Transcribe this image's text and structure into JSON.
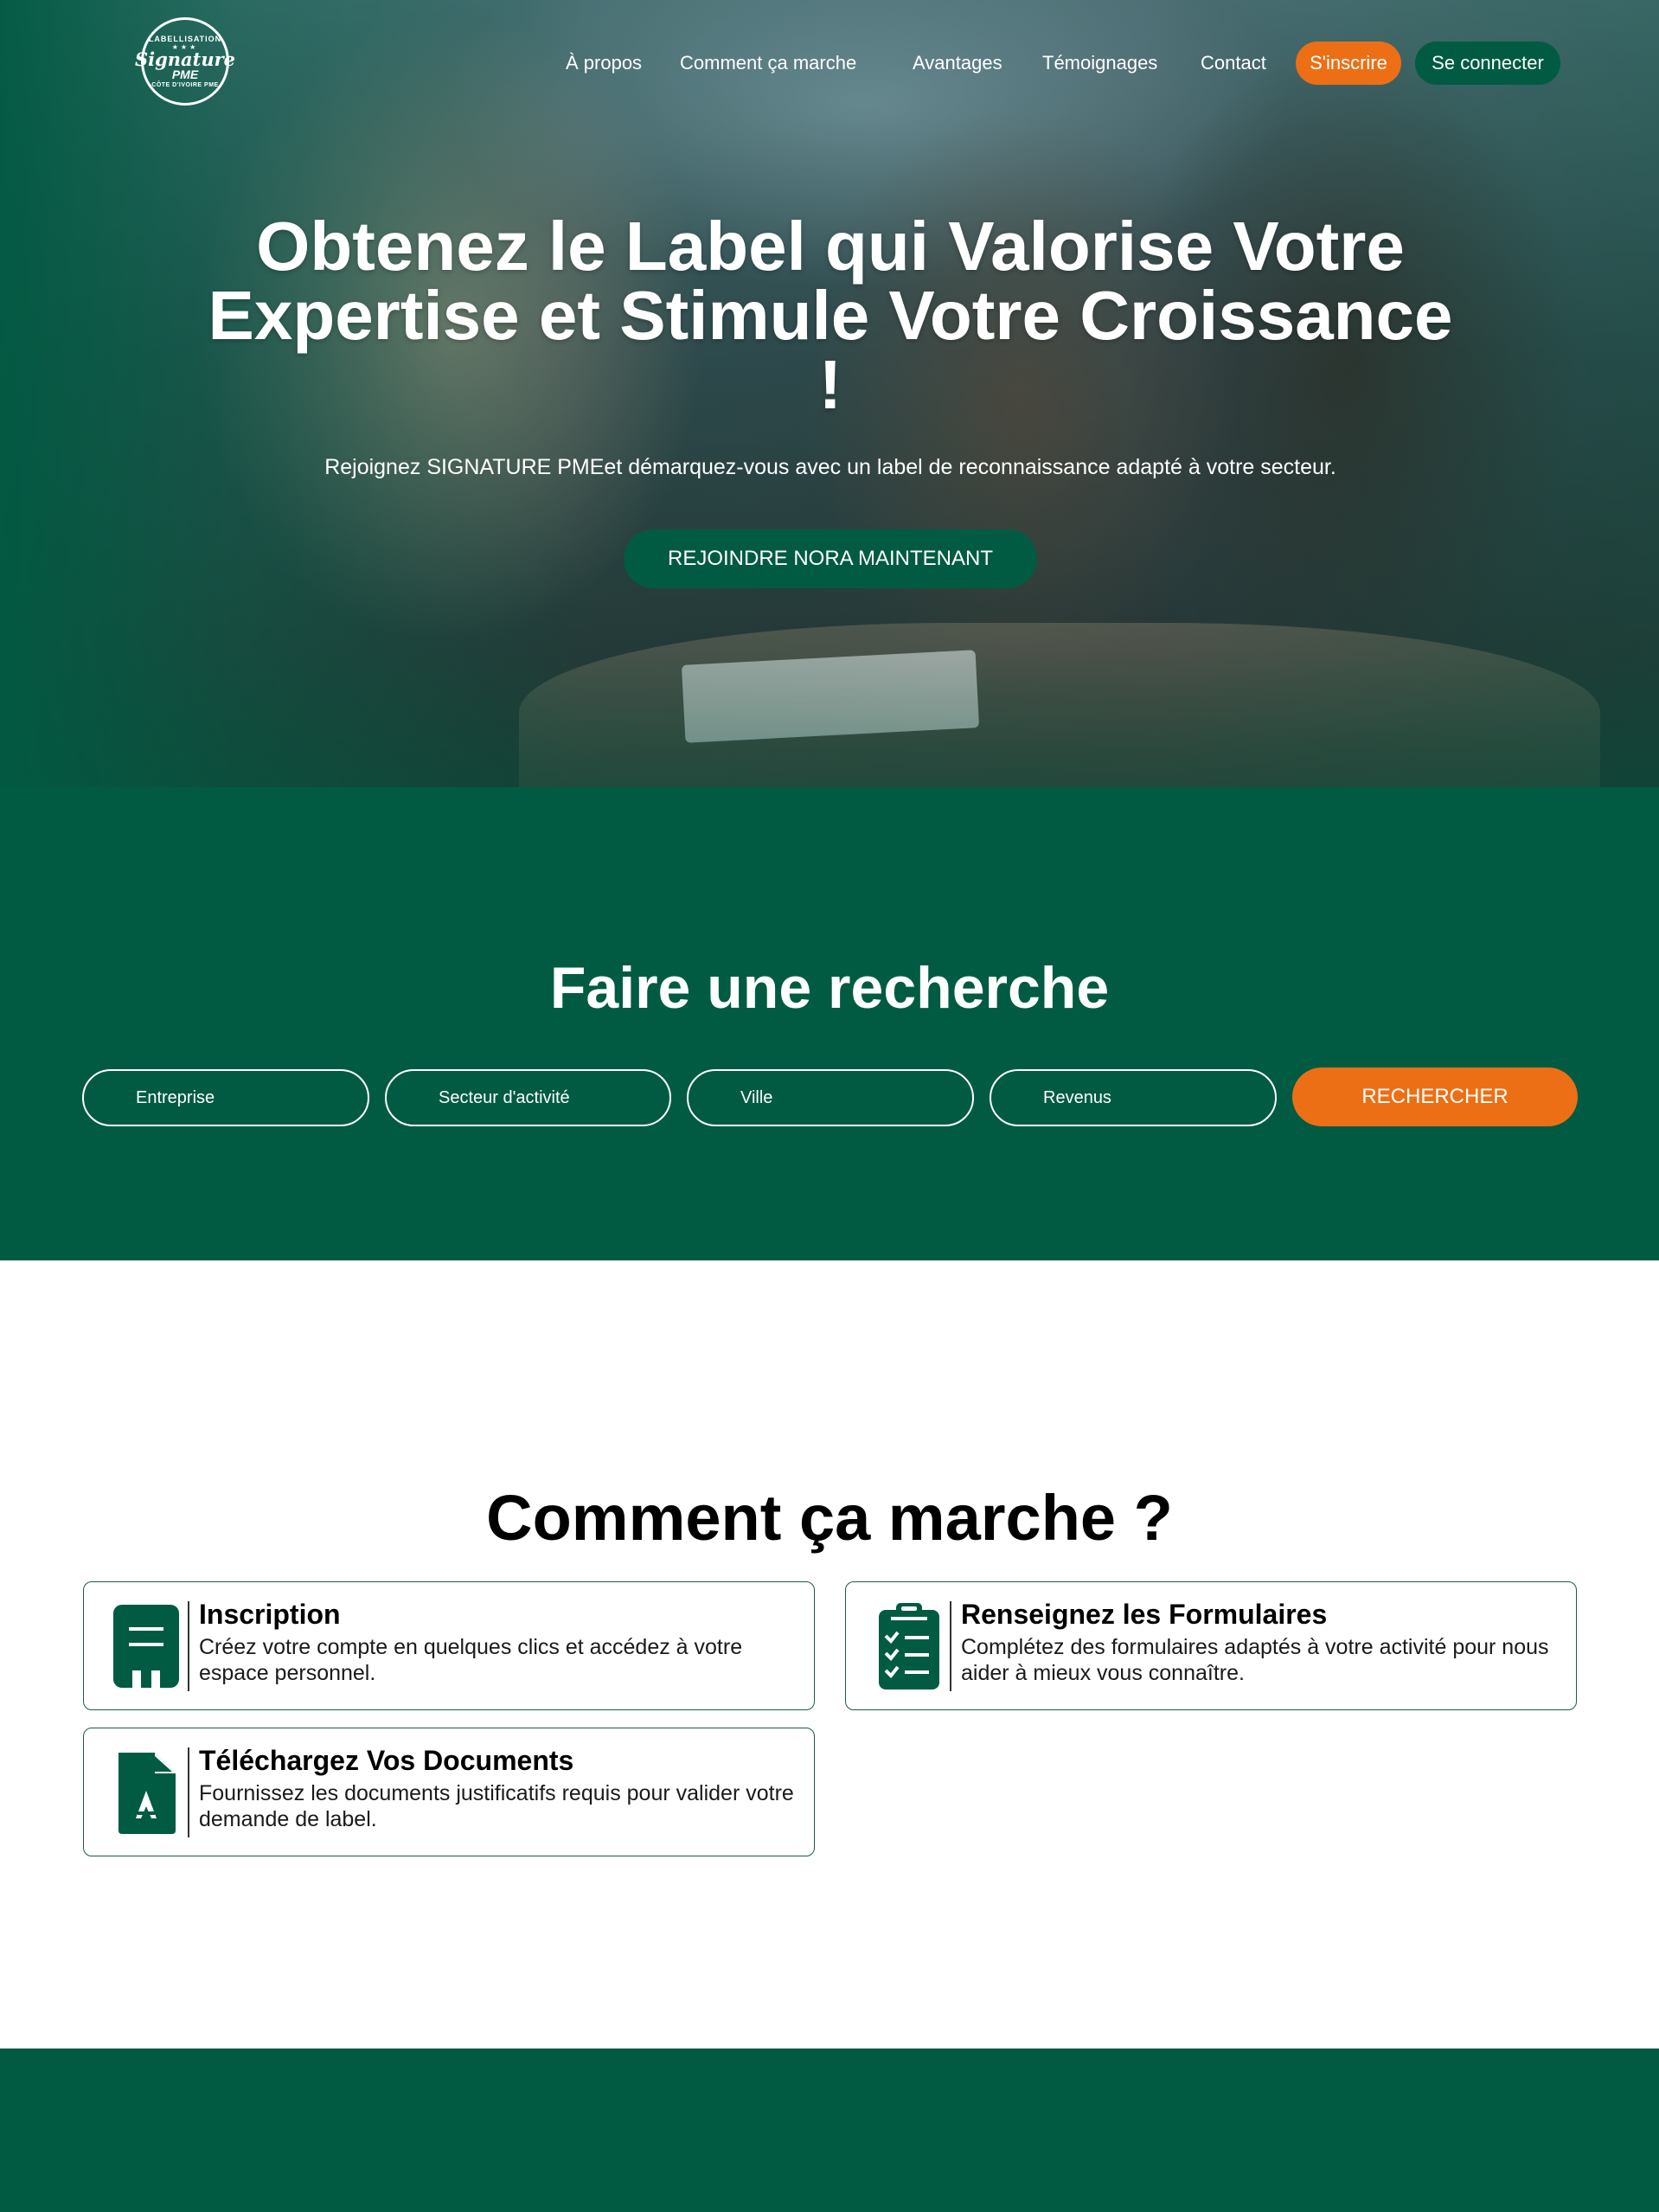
{
  "brand": {
    "logo_top_text": "LABELLISATION",
    "logo_script": "Signature",
    "logo_pme": "PME",
    "logo_bottom_text": "CÔTE D'IVOIRE PME"
  },
  "nav": {
    "items": [
      "À propos",
      "Comment ça marche",
      "Avantages",
      "Témoignages",
      "Contact"
    ],
    "signup_label": "S'inscrire",
    "login_label": "Se connecter"
  },
  "hero": {
    "title": "Obtenez le Label qui Valorise Votre Expertise et Stimule Votre Croissance !",
    "subtitle": "Rejoignez SIGNATURE PMEet démarquez-vous avec un label de reconnaissance adapté à votre secteur.",
    "cta_label": "REJOINDRE NORA MAINTENANT"
  },
  "search": {
    "title": "Faire une recherche",
    "fields": [
      "Entreprise",
      "Secteur d'activité",
      "Ville",
      "Revenus"
    ],
    "button_label": "RECHERCHER"
  },
  "how": {
    "title": "Comment ça marche ?",
    "steps": [
      {
        "icon": "document-icon",
        "title": "Inscription",
        "description": "Créez votre compte en quelques clics et accédez à votre espace personnel."
      },
      {
        "icon": "clipboard-checklist-icon",
        "title": "Renseignez les Formulaires",
        "description": "Complétez des formulaires adaptés à votre activité pour nous aider à mieux vous connaître."
      },
      {
        "icon": "pdf-file-icon",
        "title": "Téléchargez Vos Documents",
        "description": "Fournissez les documents justificatifs requis pour valider votre demande de label."
      }
    ]
  },
  "colors": {
    "brand_green": "#005b42",
    "accent_orange": "#ec6f16",
    "white": "#ffffff"
  }
}
